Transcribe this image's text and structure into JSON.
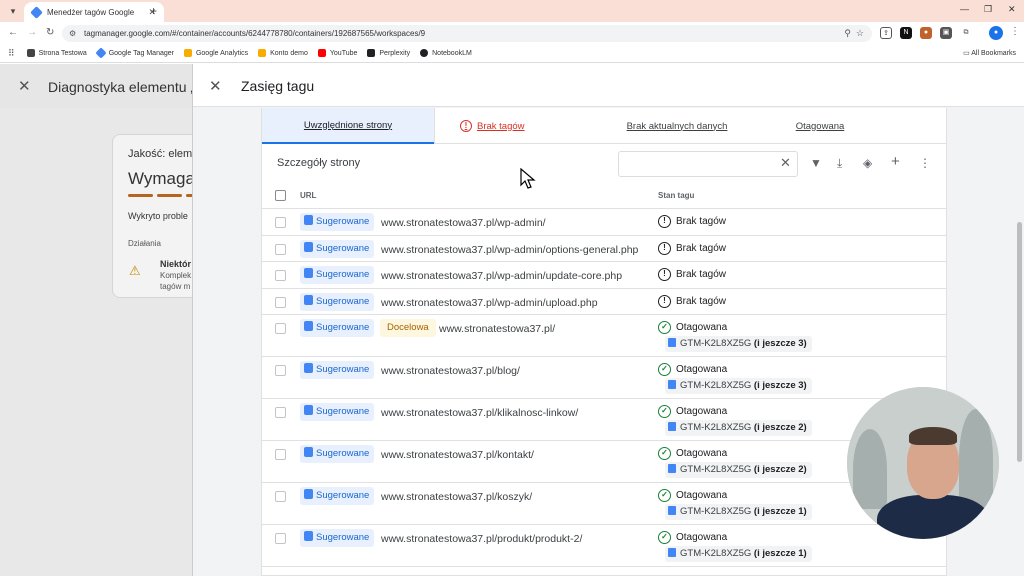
{
  "browser": {
    "tab_title": "Menedżer tagów Google",
    "url": "tagmanager.google.com/#/container/accounts/6244778780/containers/192687565/workspaces/9",
    "bookmarks": [
      {
        "label": "Strona Testowa",
        "color": "#444444"
      },
      {
        "label": "Google Tag Manager",
        "color": "#4285f4"
      },
      {
        "label": "Google Analytics",
        "color": "#f9ab00"
      },
      {
        "label": "Konto demo",
        "color": "#f9ab00"
      },
      {
        "label": "YouTube",
        "color": "#ff0000"
      },
      {
        "label": "Perplexity",
        "color": "#202124"
      },
      {
        "label": "NotebookLM",
        "color": "#202124"
      }
    ],
    "all_bookmarks": "All Bookmarks"
  },
  "background_page": {
    "title": "Diagnostyka elementu „L",
    "quality_label": "Jakość: elem",
    "status_heading": "Wymaga",
    "detected": "Wykryto proble",
    "actions_label": "Działania",
    "issue_title": "Niektór",
    "issue_line1": "Komplek",
    "issue_line2": "tagów m"
  },
  "panel": {
    "title": "Zasięg tagu",
    "tabs": [
      {
        "label": "Uwzględnione strony",
        "state": "active"
      },
      {
        "label": "Brak tagów",
        "state": "error"
      },
      {
        "label": "Brak aktualnych danych",
        "state": "normal"
      },
      {
        "label": "Otagowana",
        "state": "normal"
      }
    ],
    "details_title": "Szczegóły strony",
    "search_value": "",
    "columns": {
      "url": "URL",
      "status": "Stan tagu"
    },
    "rows": [
      {
        "badge": "Sugerowane",
        "extra_badge": "",
        "url": "www.stronatestowa37.pl/wp-admin/",
        "status": "Brak tagów",
        "status_type": "error",
        "tag": "",
        "tag_more": ""
      },
      {
        "badge": "Sugerowane",
        "extra_badge": "",
        "url": "www.stronatestowa37.pl/wp-admin/options-general.php",
        "status": "Brak tagów",
        "status_type": "error",
        "tag": "",
        "tag_more": ""
      },
      {
        "badge": "Sugerowane",
        "extra_badge": "",
        "url": "www.stronatestowa37.pl/wp-admin/update-core.php",
        "status": "Brak tagów",
        "status_type": "error",
        "tag": "",
        "tag_more": ""
      },
      {
        "badge": "Sugerowane",
        "extra_badge": "",
        "url": "www.stronatestowa37.pl/wp-admin/upload.php",
        "status": "Brak tagów",
        "status_type": "error",
        "tag": "",
        "tag_more": ""
      },
      {
        "badge": "Sugerowane",
        "extra_badge": "Docelowa",
        "url": "www.stronatestowa37.pl/",
        "status": "Otagowana",
        "status_type": "ok",
        "tag": "GTM-K2L8XZ5G",
        "tag_more": "(i jeszcze 3)"
      },
      {
        "badge": "Sugerowane",
        "extra_badge": "",
        "url": "www.stronatestowa37.pl/blog/",
        "status": "Otagowana",
        "status_type": "ok",
        "tag": "GTM-K2L8XZ5G",
        "tag_more": "(i jeszcze 3)"
      },
      {
        "badge": "Sugerowane",
        "extra_badge": "",
        "url": "www.stronatestowa37.pl/klikalnosc-linkow/",
        "status": "Otagowana",
        "status_type": "ok",
        "tag": "GTM-K2L8XZ5G",
        "tag_more": "(i jeszcze 2)"
      },
      {
        "badge": "Sugerowane",
        "extra_badge": "",
        "url": "www.stronatestowa37.pl/kontakt/",
        "status": "Otagowana",
        "status_type": "ok",
        "tag": "GTM-K2L8XZ5G",
        "tag_more": "(i jeszcze 2)"
      },
      {
        "badge": "Sugerowane",
        "extra_badge": "",
        "url": "www.stronatestowa37.pl/koszyk/",
        "status": "Otagowana",
        "status_type": "ok",
        "tag": "GTM-K2L8XZ5G",
        "tag_more": "(i jeszcze 1)"
      },
      {
        "badge": "Sugerowane",
        "extra_badge": "",
        "url": "www.stronatestowa37.pl/produkt/produkt-2/",
        "status": "Otagowana",
        "status_type": "ok",
        "tag": "GTM-K2L8XZ5G",
        "tag_more": "(i jeszcze 1)"
      }
    ]
  },
  "colors": {
    "accent": "#1a73e8",
    "error": "#d93025",
    "ok": "#188038",
    "badge_bg": "#e8f0fe",
    "target_badge_bg": "#fef7e0"
  }
}
